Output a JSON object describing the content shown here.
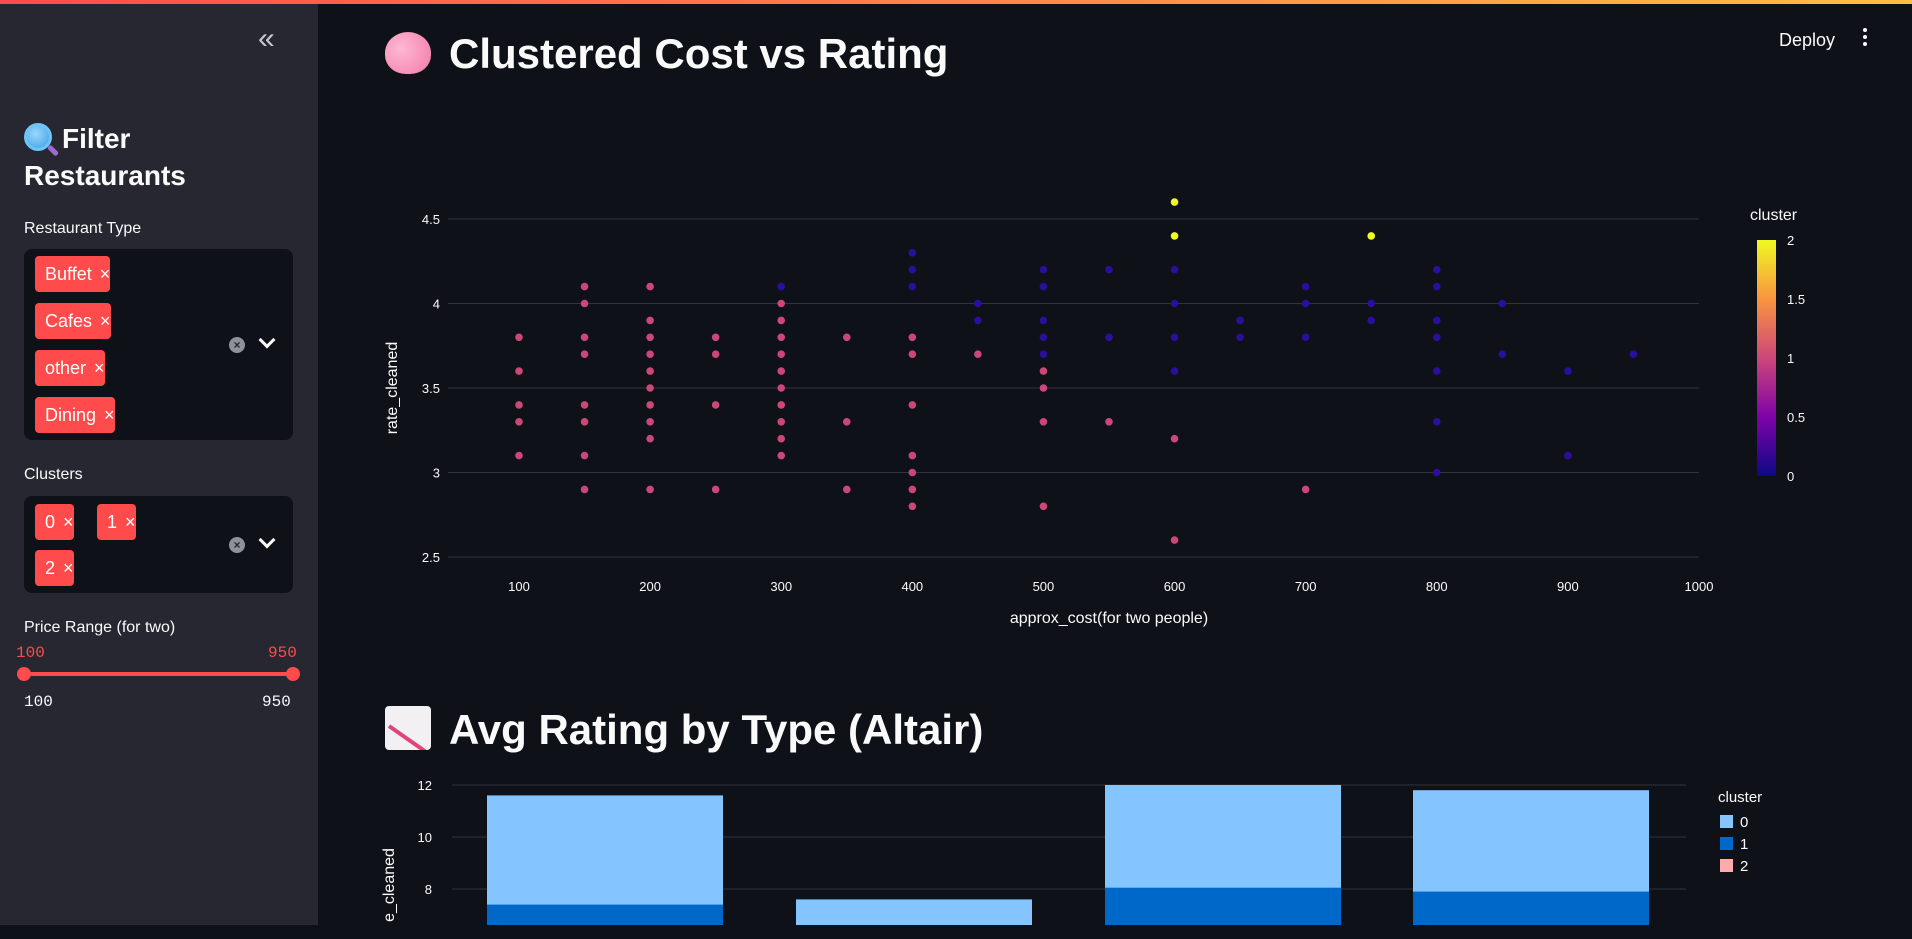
{
  "app": {
    "deploy_label": "Deploy"
  },
  "sidebar": {
    "title": "Filter Restaurants",
    "restaurant_type_label": "Restaurant Type",
    "restaurant_types": [
      "Buffet",
      "Cafes",
      "other",
      "Dining"
    ],
    "clusters_label": "Clusters",
    "clusters": [
      "0",
      "1",
      "2"
    ],
    "price_label": "Price Range (for two)",
    "price_min": "100",
    "price_max": "950",
    "price_min_bound": "100",
    "price_max_bound": "950"
  },
  "main": {
    "scatter_heading": "Clustered Cost vs Rating",
    "bar_heading": "Avg Rating by Type (Altair)"
  },
  "chart_data": [
    {
      "type": "scatter",
      "xlabel": "approx_cost(for two people)",
      "ylabel": "rate_cleaned",
      "xlim": [
        50,
        1000
      ],
      "ylim": [
        2.45,
        4.65
      ],
      "xticks": [
        "100",
        "200",
        "300",
        "400",
        "500",
        "600",
        "700",
        "800",
        "900",
        "1000"
      ],
      "yticks": [
        "2.5",
        "3",
        "3.5",
        "4",
        "4.5"
      ],
      "colorbar": {
        "title": "cluster",
        "ticks": [
          "0",
          "0.5",
          "1",
          "1.5",
          "2"
        ],
        "colors": [
          "#0d0887",
          "#7e03a8",
          "#cc4778",
          "#f89540",
          "#f0f921"
        ]
      },
      "grid": true,
      "points": [
        [
          100,
          3.8,
          1
        ],
        [
          100,
          3.6,
          1
        ],
        [
          100,
          3.4,
          1
        ],
        [
          100,
          3.3,
          1
        ],
        [
          100,
          3.1,
          1
        ],
        [
          150,
          4.1,
          1
        ],
        [
          150,
          4.0,
          1
        ],
        [
          150,
          3.8,
          1
        ],
        [
          150,
          3.7,
          1
        ],
        [
          150,
          3.4,
          1
        ],
        [
          150,
          3.3,
          1
        ],
        [
          150,
          3.1,
          1
        ],
        [
          150,
          2.9,
          1
        ],
        [
          200,
          4.1,
          1
        ],
        [
          200,
          3.9,
          1
        ],
        [
          200,
          3.8,
          1
        ],
        [
          200,
          3.7,
          1
        ],
        [
          200,
          3.6,
          1
        ],
        [
          200,
          3.5,
          1
        ],
        [
          200,
          3.4,
          1
        ],
        [
          200,
          3.3,
          1
        ],
        [
          200,
          3.2,
          1
        ],
        [
          200,
          2.9,
          1
        ],
        [
          250,
          3.8,
          1
        ],
        [
          250,
          3.7,
          1
        ],
        [
          250,
          3.4,
          1
        ],
        [
          250,
          2.9,
          1
        ],
        [
          300,
          4.1,
          0
        ],
        [
          300,
          4.0,
          1
        ],
        [
          300,
          3.9,
          1
        ],
        [
          300,
          3.8,
          1
        ],
        [
          300,
          3.7,
          1
        ],
        [
          300,
          3.6,
          1
        ],
        [
          300,
          3.5,
          1
        ],
        [
          300,
          3.4,
          1
        ],
        [
          300,
          3.3,
          1
        ],
        [
          300,
          3.2,
          1
        ],
        [
          300,
          3.1,
          1
        ],
        [
          350,
          3.8,
          1
        ],
        [
          350,
          3.3,
          1
        ],
        [
          350,
          2.9,
          1
        ],
        [
          400,
          4.3,
          0
        ],
        [
          400,
          4.2,
          0
        ],
        [
          400,
          4.1,
          0
        ],
        [
          400,
          3.8,
          1
        ],
        [
          400,
          3.7,
          1
        ],
        [
          400,
          3.4,
          1
        ],
        [
          400,
          3.1,
          1
        ],
        [
          400,
          3.0,
          1
        ],
        [
          400,
          2.9,
          1
        ],
        [
          400,
          2.8,
          1
        ],
        [
          450,
          4.0,
          0
        ],
        [
          450,
          3.9,
          0
        ],
        [
          450,
          3.7,
          1
        ],
        [
          500,
          4.2,
          0
        ],
        [
          500,
          4.1,
          0
        ],
        [
          500,
          3.9,
          0
        ],
        [
          500,
          3.8,
          0
        ],
        [
          500,
          3.7,
          0
        ],
        [
          500,
          3.6,
          1
        ],
        [
          500,
          3.5,
          1
        ],
        [
          500,
          3.3,
          1
        ],
        [
          500,
          2.8,
          1
        ],
        [
          550,
          4.2,
          0
        ],
        [
          550,
          3.8,
          0
        ],
        [
          550,
          3.3,
          1
        ],
        [
          600,
          4.6,
          2
        ],
        [
          600,
          4.4,
          2
        ],
        [
          600,
          4.2,
          0
        ],
        [
          600,
          4.0,
          0
        ],
        [
          600,
          3.8,
          0
        ],
        [
          600,
          3.6,
          0
        ],
        [
          600,
          3.2,
          1
        ],
        [
          600,
          2.6,
          1
        ],
        [
          650,
          3.9,
          0
        ],
        [
          650,
          3.8,
          0
        ],
        [
          700,
          4.1,
          0
        ],
        [
          700,
          4.0,
          0
        ],
        [
          700,
          3.8,
          0
        ],
        [
          700,
          2.9,
          1
        ],
        [
          750,
          4.4,
          2
        ],
        [
          750,
          4.0,
          0
        ],
        [
          750,
          3.9,
          0
        ],
        [
          800,
          4.2,
          0
        ],
        [
          800,
          4.1,
          0
        ],
        [
          800,
          3.9,
          0
        ],
        [
          800,
          3.8,
          0
        ],
        [
          800,
          3.6,
          0
        ],
        [
          800,
          3.3,
          0
        ],
        [
          800,
          3.0,
          0
        ],
        [
          850,
          4.0,
          0
        ],
        [
          850,
          3.7,
          0
        ],
        [
          900,
          3.6,
          0
        ],
        [
          900,
          3.1,
          0
        ],
        [
          950,
          3.7,
          0
        ]
      ]
    },
    {
      "type": "bar",
      "ylabel": "e_cleaned",
      "yticks": [
        "8",
        "10",
        "12"
      ],
      "ylim": [
        6.5,
        12.1
      ],
      "legend": {
        "title": "cluster",
        "entries": [
          "0",
          "1",
          "2"
        ],
        "colors": [
          "#85c5ff",
          "#0068c9",
          "#ffabab"
        ]
      },
      "stacked": true,
      "bars": [
        {
          "cluster0_top": 11.6,
          "cluster1_top": 7.4
        },
        {
          "cluster0_top": 7.6,
          "cluster1_top": 6.5
        },
        {
          "cluster0_top": 12.0,
          "cluster1_top": 8.05
        },
        {
          "cluster0_top": 11.8,
          "cluster1_top": 7.9
        }
      ]
    }
  ]
}
